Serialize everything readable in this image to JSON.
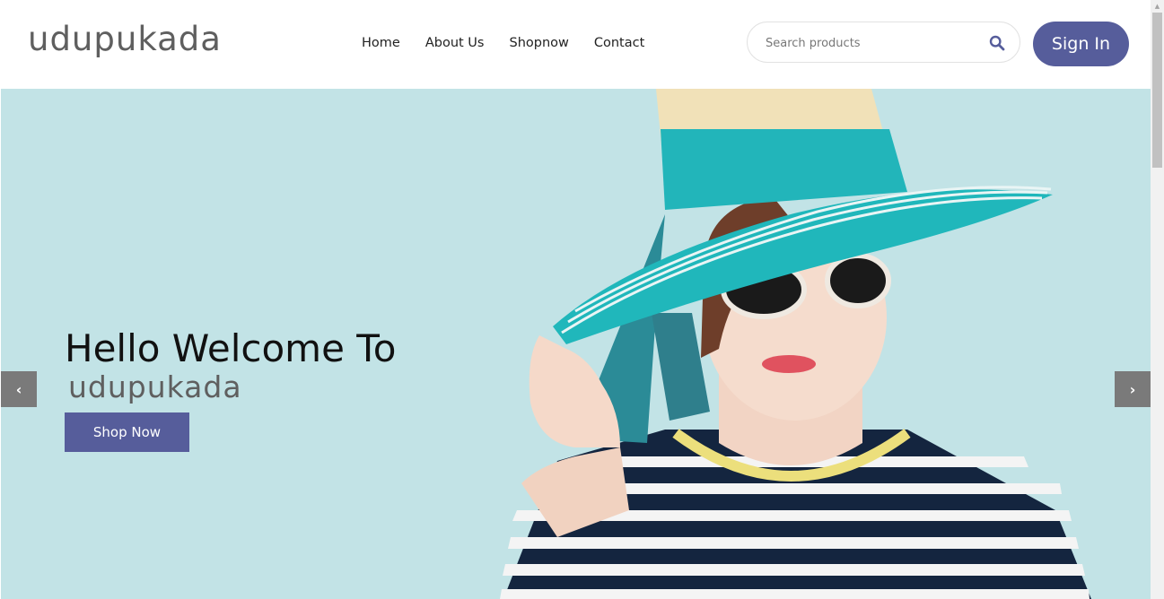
{
  "header": {
    "logo": "udupukada",
    "nav": [
      "Home",
      "About Us",
      "Shopnow",
      "Contact"
    ],
    "search": {
      "placeholder": "Search products",
      "value": ""
    },
    "signin_label": "Sign In"
  },
  "hero": {
    "heading": "Hello Welcome To",
    "brand": "udupukada",
    "cta_label": "Shop Now",
    "prev_icon": "‹",
    "next_icon": "›"
  },
  "colors": {
    "accent": "#565d9b",
    "hero_background": "#c2e3e6",
    "logo": "#5f5f5f",
    "hat_band": "#1fb5b8"
  },
  "icons": [
    "search-icon",
    "chevron-left-icon",
    "chevron-right-icon"
  ]
}
